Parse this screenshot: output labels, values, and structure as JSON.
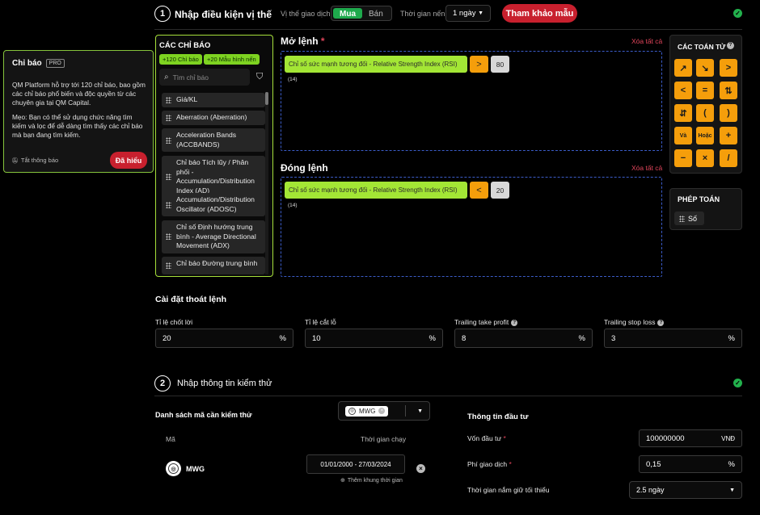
{
  "step1": {
    "number": "1",
    "title": "Nhập điều kiện vị thế",
    "position_label": "Vị thế giao dịch",
    "position_options": [
      "Mua",
      "Bán"
    ],
    "position_selected": "Mua",
    "timeframe_label": "Thời gian nến",
    "timeframe_value": "1 ngày",
    "reference_button": "Tham khảo mẫu"
  },
  "tooltip": {
    "title": "Chỉ báo",
    "badge": "PRO",
    "body1": "QM Platform hỗ trợ tới 120 chỉ báo, bao gồm các chỉ báo phổ biến và độc quyền từ các chuyên gia tại QM Capital.",
    "body2": "Mẹo: Bạn có thể sử dụng chức năng tìm kiếm và lọc để dễ dàng tìm thấy các chỉ báo mà bạn đang tìm kiếm.",
    "dismiss": "Tắt thông báo",
    "ok_button": "Đã hiểu"
  },
  "indicators": {
    "title": "CÁC CHỈ BÁO",
    "tags": [
      "+120 Chỉ báo",
      "+20 Mẫu hình nến"
    ],
    "search_placeholder": "Tìm chỉ báo",
    "items": [
      "Giá/KL",
      "Aberration (Aberration)",
      "Acceleration Bands (ACCBANDS)",
      "Chỉ báo Tích lũy / Phân phối - Accumulation/Distribution Index (AD)",
      "Accumulation/Distribution Oscillator (ADOSC)",
      "Chỉ số Định hướng trung bình - Average Directional Movement (ADX)",
      "Chỉ báo Đường trung bình"
    ]
  },
  "open_rule": {
    "title": "Mở lệnh",
    "required": "*",
    "clear": "Xóa tất cả",
    "indicator": "Chỉ số sức mạnh tương đối - Relative Strength Index (RSI)",
    "operator": ">",
    "value": "80",
    "param": "(14)"
  },
  "close_rule": {
    "title": "Đóng lệnh",
    "clear": "Xóa tất cả",
    "indicator": "Chỉ số sức mạnh tương đối - Relative Strength Index (RSI)",
    "operator": "<",
    "value": "20",
    "param": "(14)"
  },
  "operators": {
    "title": "CÁC TOÁN TỬ",
    "buttons": [
      "↗",
      "↘",
      ">",
      "<",
      "=",
      "⇅",
      "⇵",
      "(",
      ")",
      "Và",
      "Hoặc",
      "+",
      "−",
      "×",
      "/"
    ]
  },
  "math": {
    "title": "PHÉP TOÁN",
    "number_chip": "Số"
  },
  "exit_settings": {
    "title": "Cài đặt thoát lệnh",
    "fields": [
      {
        "label": "Tỉ lệ chốt lời",
        "value": "20",
        "unit": "%",
        "info": false
      },
      {
        "label": "Tỉ lệ cắt lỗ",
        "value": "10",
        "unit": "%",
        "info": false
      },
      {
        "label": "Trailing take profit",
        "value": "8",
        "unit": "%",
        "info": true
      },
      {
        "label": "Trailing stop loss",
        "value": "3",
        "unit": "%",
        "info": true
      }
    ]
  },
  "step2": {
    "number": "2",
    "title": "Nhập thông tin kiểm thử",
    "list_title": "Danh sách mã cần kiểm thử",
    "ticker_select": "MWG",
    "col_code": "Mã",
    "col_time": "Thời gian chạy",
    "row_code": "MWG",
    "row_range": "01/01/2000 - 27/03/2024",
    "add_range": "Thêm khung thời gian"
  },
  "investment": {
    "title": "Thông tin đầu tư",
    "capital_label": "Vốn đầu tư",
    "capital_value": "100000000",
    "capital_unit": "VNĐ",
    "fee_label": "Phí giao dịch",
    "fee_value": "0,15",
    "fee_unit": "%",
    "hold_label": "Thời gian nắm giữ tối thiểu",
    "hold_value": "2.5 ngày",
    "required": "*"
  },
  "colors": {
    "accent_green": "#1ea94c",
    "lime": "#a3e635",
    "orange": "#f59e0b",
    "red": "#c8202e",
    "dashed_border": "#3b5cc8"
  }
}
